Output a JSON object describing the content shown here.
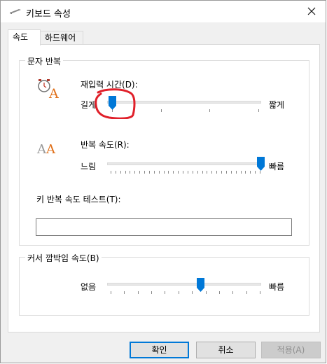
{
  "window": {
    "title": "키보드 속성",
    "close_icon": "close-icon"
  },
  "tabs": [
    {
      "label": "속도",
      "active": true
    },
    {
      "label": "하드웨어",
      "active": false
    }
  ],
  "character_repeat": {
    "group_title": "문자 반복",
    "repeat_delay": {
      "label": "재입력 시간(D):",
      "min_label": "길게",
      "max_label": "짧게",
      "value_fraction": 0.0
    },
    "repeat_rate": {
      "label": "반복 속도(R):",
      "min_label": "느림",
      "max_label": "빠름",
      "value_fraction": 1.0
    },
    "test_label": "키 반복 속도 테스트(T):",
    "test_value": ""
  },
  "cursor_blink": {
    "group_title": "커서 깜박임 속도(B)",
    "min_label": "없음",
    "max_label": "빠름",
    "value_fraction": 0.6
  },
  "buttons": {
    "ok": "확인",
    "cancel": "취소",
    "apply": "적용(A)"
  },
  "colors": {
    "accent": "#0078d7",
    "annotation": "#e0202a"
  }
}
